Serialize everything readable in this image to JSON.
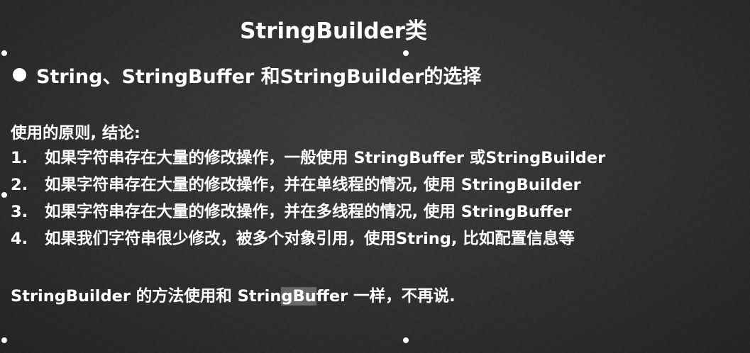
{
  "slide": {
    "title": "StringBuilder类",
    "bullet": "String、StringBuffer 和StringBuilder的选择",
    "principle_heading": "使用的原则, 结论:",
    "items": [
      {
        "num": "1.",
        "text": "如果字符串存在大量的修改操作，一般使用 StringBuffer 或StringBuilder"
      },
      {
        "num": "2.",
        "text": "如果字符串存在大量的修改操作，并在单线程的情况, 使用  StringBuilder"
      },
      {
        "num": "3.",
        "text": "如果字符串存在大量的修改操作，并在多线程的情况, 使用  StringBuffer"
      },
      {
        "num": "4.",
        "text": "如果我们字符串很少修改，被多个对象引用，使用String, 比如配置信息等"
      }
    ],
    "final_before": "StringBuilder 的方法使用和 Strin",
    "final_highlight": "gBu",
    "final_after": "ffer 一样，不再说."
  }
}
